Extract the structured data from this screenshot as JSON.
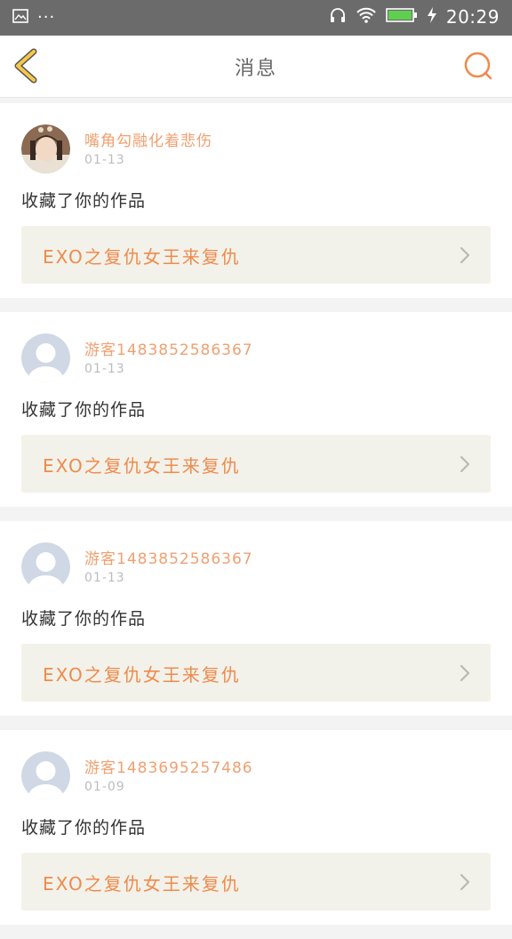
{
  "status_bar": {
    "time": "20:29",
    "dots": "···",
    "icons": [
      "image-icon",
      "headphones-icon",
      "wifi-icon",
      "battery-icon",
      "charging-icon"
    ]
  },
  "header": {
    "title": "消息",
    "back_icon": "chevron-left-icon",
    "search_icon": "search-icon"
  },
  "colors": {
    "accent": "#f08a4c",
    "username": "#f0a070",
    "back_arrow": "#f5c84a",
    "work_box_bg": "#f3f2ea"
  },
  "messages": [
    {
      "username": "嘴角勾融化着悲伤",
      "date": "01-13",
      "action": "收藏了你的作品",
      "work_title": "EXO之复仇女王来复仇",
      "avatar": "photo"
    },
    {
      "username": "游客1483852586367",
      "date": "01-13",
      "action": "收藏了你的作品",
      "work_title": "EXO之复仇女王来复仇",
      "avatar": "default"
    },
    {
      "username": "游客1483852586367",
      "date": "01-13",
      "action": "收藏了你的作品",
      "work_title": "EXO之复仇女王来复仇",
      "avatar": "default"
    },
    {
      "username": "游客1483695257486",
      "date": "01-09",
      "action": "收藏了你的作品",
      "work_title": "EXO之复仇女王来复仇",
      "avatar": "default"
    }
  ]
}
